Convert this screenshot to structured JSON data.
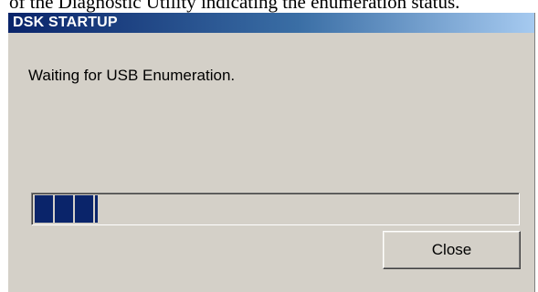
{
  "caption": "of the Diagnostic Utility indicating the enumeration status.",
  "window": {
    "title": "DSK STARTUP",
    "message": "Waiting for USB Enumeration.",
    "progress_percent": 13,
    "close_label": "Close"
  },
  "colors": {
    "title_bar_start": "#0a246a",
    "title_bar_end": "#a6caf0",
    "progress_block": "#0a246a",
    "dialog_face": "#d4d0c8"
  }
}
